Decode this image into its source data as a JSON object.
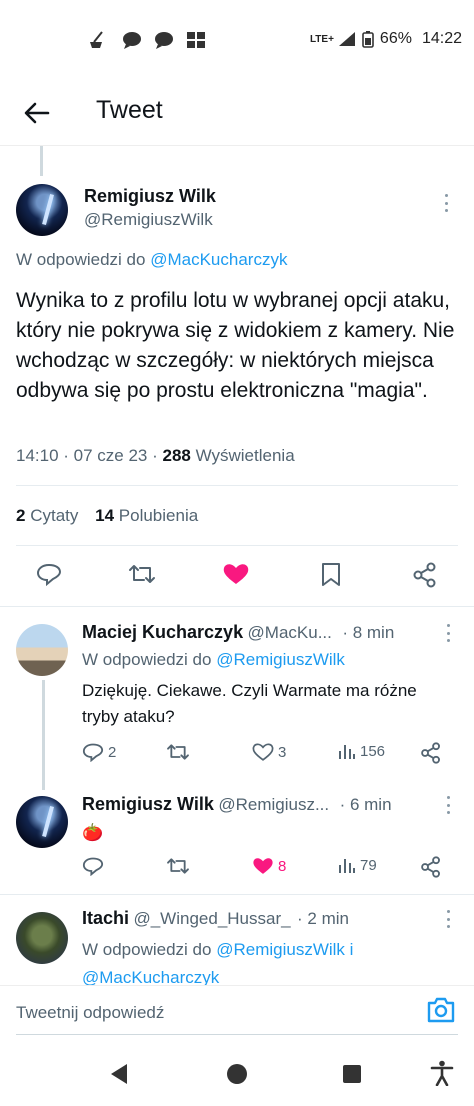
{
  "status_bar": {
    "network": "LTE+",
    "battery": "66%",
    "time": "14:22"
  },
  "header": {
    "title": "Tweet"
  },
  "main_tweet": {
    "name": "Remigiusz Wilk",
    "handle": "@RemigiuszWilk",
    "reply_to_prefix": "W odpowiedzi do",
    "reply_to": "@MacKucharczyk",
    "text": "Wynika to z profilu lotu w wybranej opcji ataku, który nie pokrywa się z widokiem z kamery. Nie wchodząc w szczegóły: w niektórych miejsca odbywa się po prostu elektroniczna \"magia\".",
    "time_date": "14:10 · 07 cze 23 ·",
    "views_count": "288",
    "views_label": "Wyświetlenia",
    "quotes_count": "2",
    "quotes_label": "Cytaty",
    "likes_count": "14",
    "likes_label": "Polubienia"
  },
  "replies": [
    {
      "name": "Maciej Kucharczyk",
      "handle": "@MacKu...",
      "time": "· 8 min",
      "reply_to_prefix": "W odpowiedzi do",
      "reply_to": "@RemigiuszWilk",
      "text": "Dziękuję. Ciekawe. Czyli Warmate ma różne tryby ataku?",
      "replies_count": "2",
      "retweets_count": "",
      "likes_count": "3",
      "views_count": "156"
    },
    {
      "name": "Remigiusz Wilk",
      "handle": "@Remigiusz...",
      "time": "· 6 min",
      "text": "🍅",
      "replies_count": "",
      "retweets_count": "",
      "likes_count": "8",
      "views_count": "79"
    },
    {
      "name": "Itachi",
      "handle": "@_Winged_Hussar_",
      "time": "· 2 min",
      "reply_to_prefix": "W odpowiedzi do",
      "reply_to": "@RemigiuszWilk i",
      "reply_to_2": "@MacKucharczyk"
    }
  ],
  "compose": {
    "placeholder": "Tweetnij odpowiedź"
  },
  "colors": {
    "accent": "#1d9bf0",
    "like": "#f91880",
    "text": "#0f1419",
    "muted": "#536471"
  }
}
